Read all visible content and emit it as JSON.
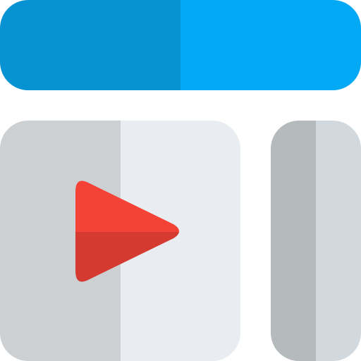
{
  "icon": {
    "name": "video-player-layout-icon",
    "colors": {
      "header_dark": "#0793d3",
      "header_light": "#03a9f4",
      "panel_dark": "#cdd0d3",
      "panel_light": "#e9edf1",
      "sidebar_dark": "#b5babd",
      "sidebar_light": "#d2d9de",
      "play_top": "#f44336",
      "play_bottom": "#d43a2f"
    }
  }
}
